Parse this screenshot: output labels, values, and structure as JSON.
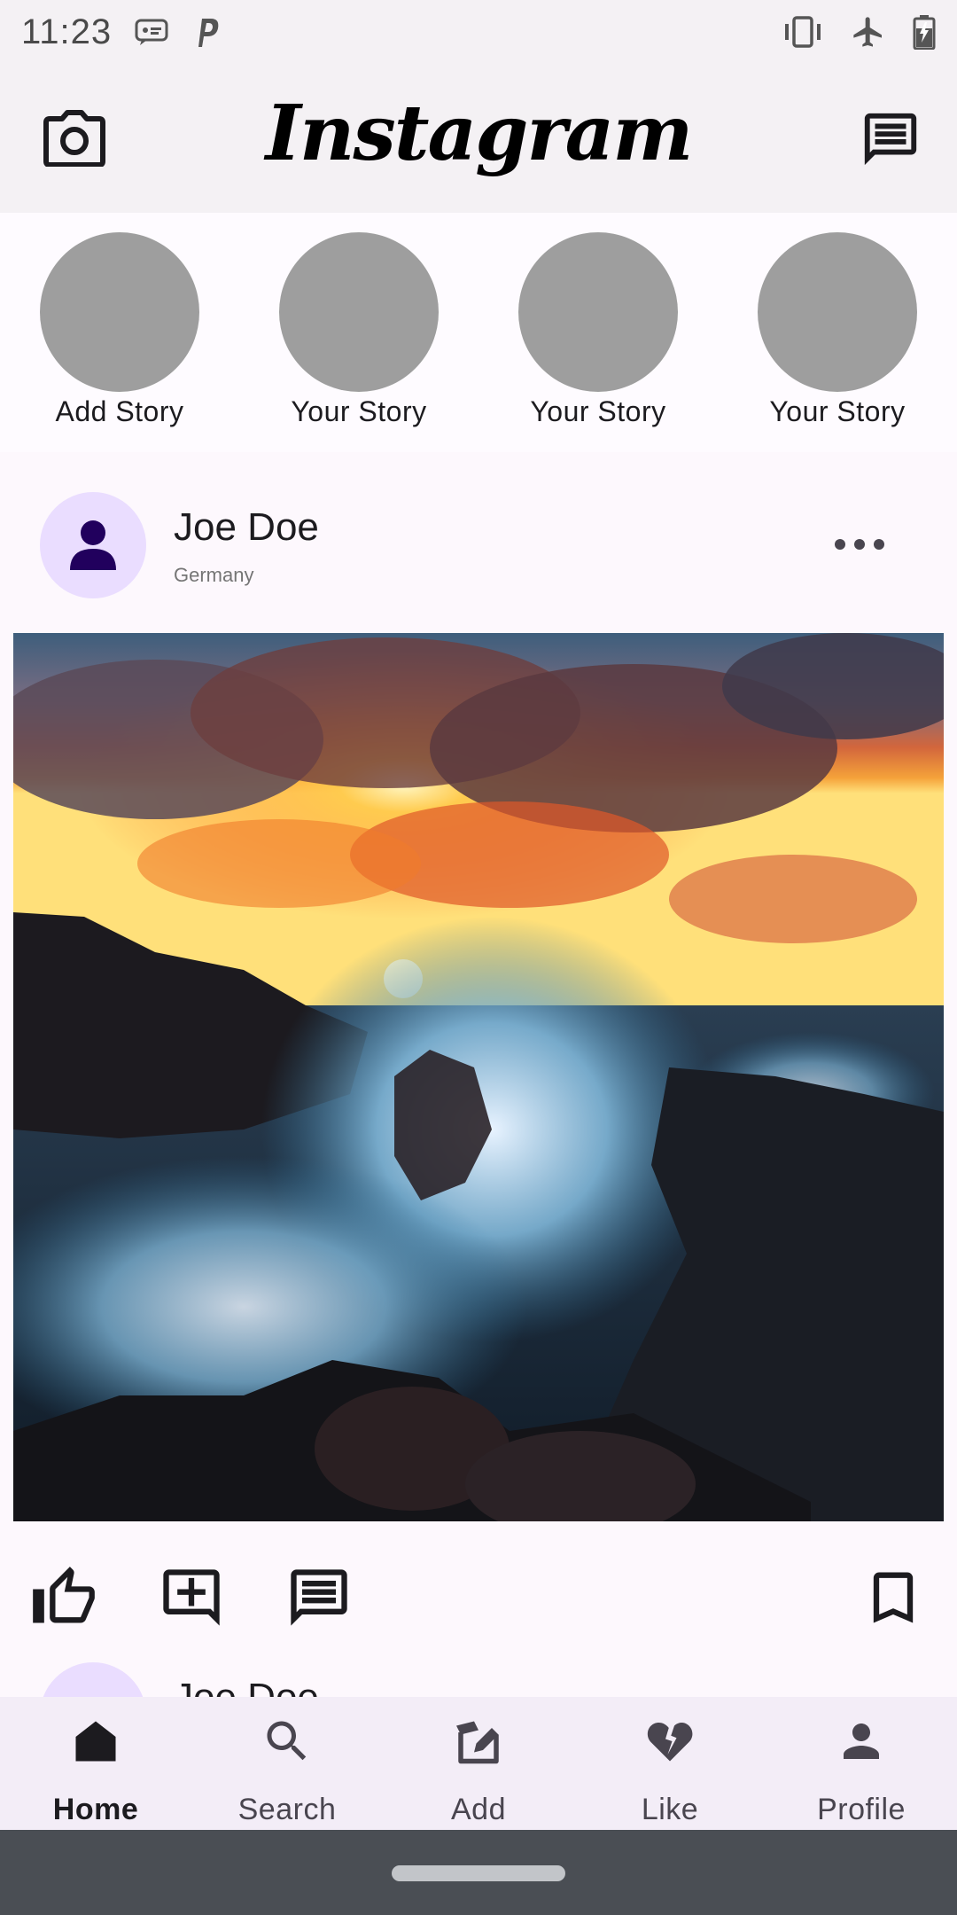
{
  "status_bar": {
    "time": "11:23",
    "left_icons": [
      "message-notification-icon",
      "parking-app-icon"
    ],
    "right_icons": [
      "vibrate-icon",
      "airplane-mode-icon",
      "battery-icon"
    ]
  },
  "app_bar": {
    "logo": "Instagram",
    "left_icon": "camera-icon",
    "right_icon": "messages-icon"
  },
  "stories": [
    {
      "label": "Add Story"
    },
    {
      "label": "Your Story"
    },
    {
      "label": "Your Story"
    },
    {
      "label": "Your Story"
    }
  ],
  "post": {
    "username": "Joe Doe",
    "location": "Germany",
    "image_icon": "sunset-wave-photo",
    "actions": [
      "like-icon",
      "add-comment-icon",
      "comments-icon",
      "bookmark-icon"
    ]
  },
  "next_post": {
    "username": "Joe Doe"
  },
  "bottom_nav": {
    "items": [
      {
        "label": "Home",
        "icon": "home-icon",
        "active": true
      },
      {
        "label": "Search",
        "icon": "search-icon",
        "active": false
      },
      {
        "label": "Add",
        "icon": "add-post-icon",
        "active": false
      },
      {
        "label": "Like",
        "icon": "broken-heart-icon",
        "active": false
      },
      {
        "label": "Profile",
        "icon": "profile-icon",
        "active": false
      }
    ]
  },
  "colors": {
    "app_bar_bg": "#f4f1f4",
    "story_avatar": "#9e9e9e",
    "post_avatar_bg": "#eaddff",
    "post_avatar_fg": "#21005d",
    "nav_bg": "#f3edf7",
    "gesture_bar_bg": "#4a4e54"
  }
}
